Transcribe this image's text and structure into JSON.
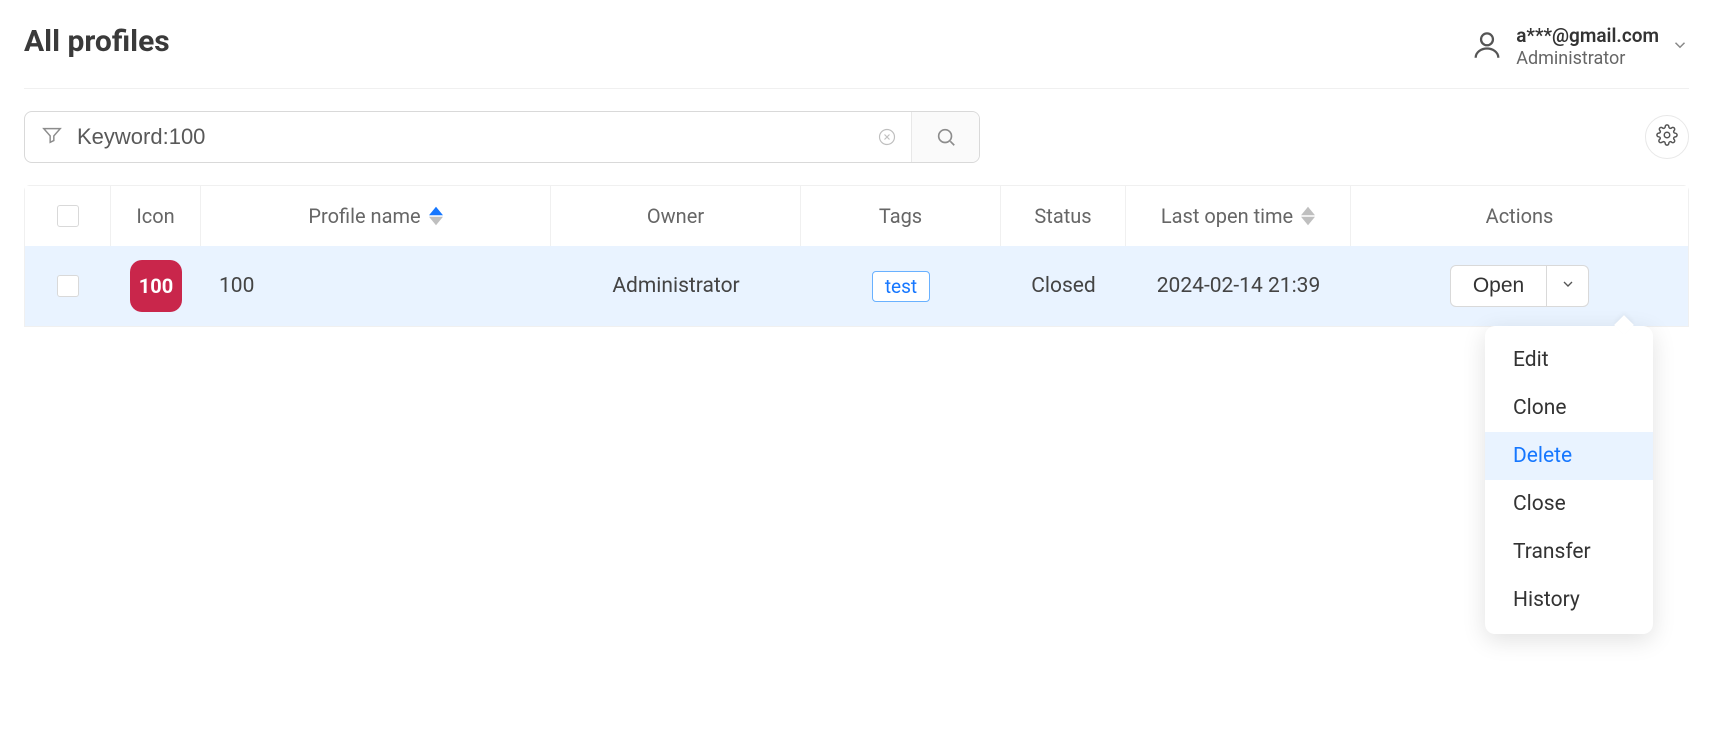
{
  "header": {
    "title": "All profiles",
    "user_email": "a***@gmail.com",
    "user_role": "Administrator"
  },
  "search": {
    "value": "Keyword:100"
  },
  "table": {
    "columns": {
      "icon": "Icon",
      "profile_name": "Profile name",
      "owner": "Owner",
      "tags": "Tags",
      "status": "Status",
      "last_open": "Last open time",
      "actions": "Actions"
    },
    "rows": [
      {
        "icon_label": "100",
        "profile_name": "100",
        "owner": "Administrator",
        "tag": "test",
        "status": "Closed",
        "last_open": "2024-02-14 21:39",
        "open_label": "Open"
      }
    ]
  },
  "dropdown": {
    "items": [
      "Edit",
      "Clone",
      "Delete",
      "Close",
      "Transfer",
      "History"
    ],
    "highlighted_index": 2
  }
}
